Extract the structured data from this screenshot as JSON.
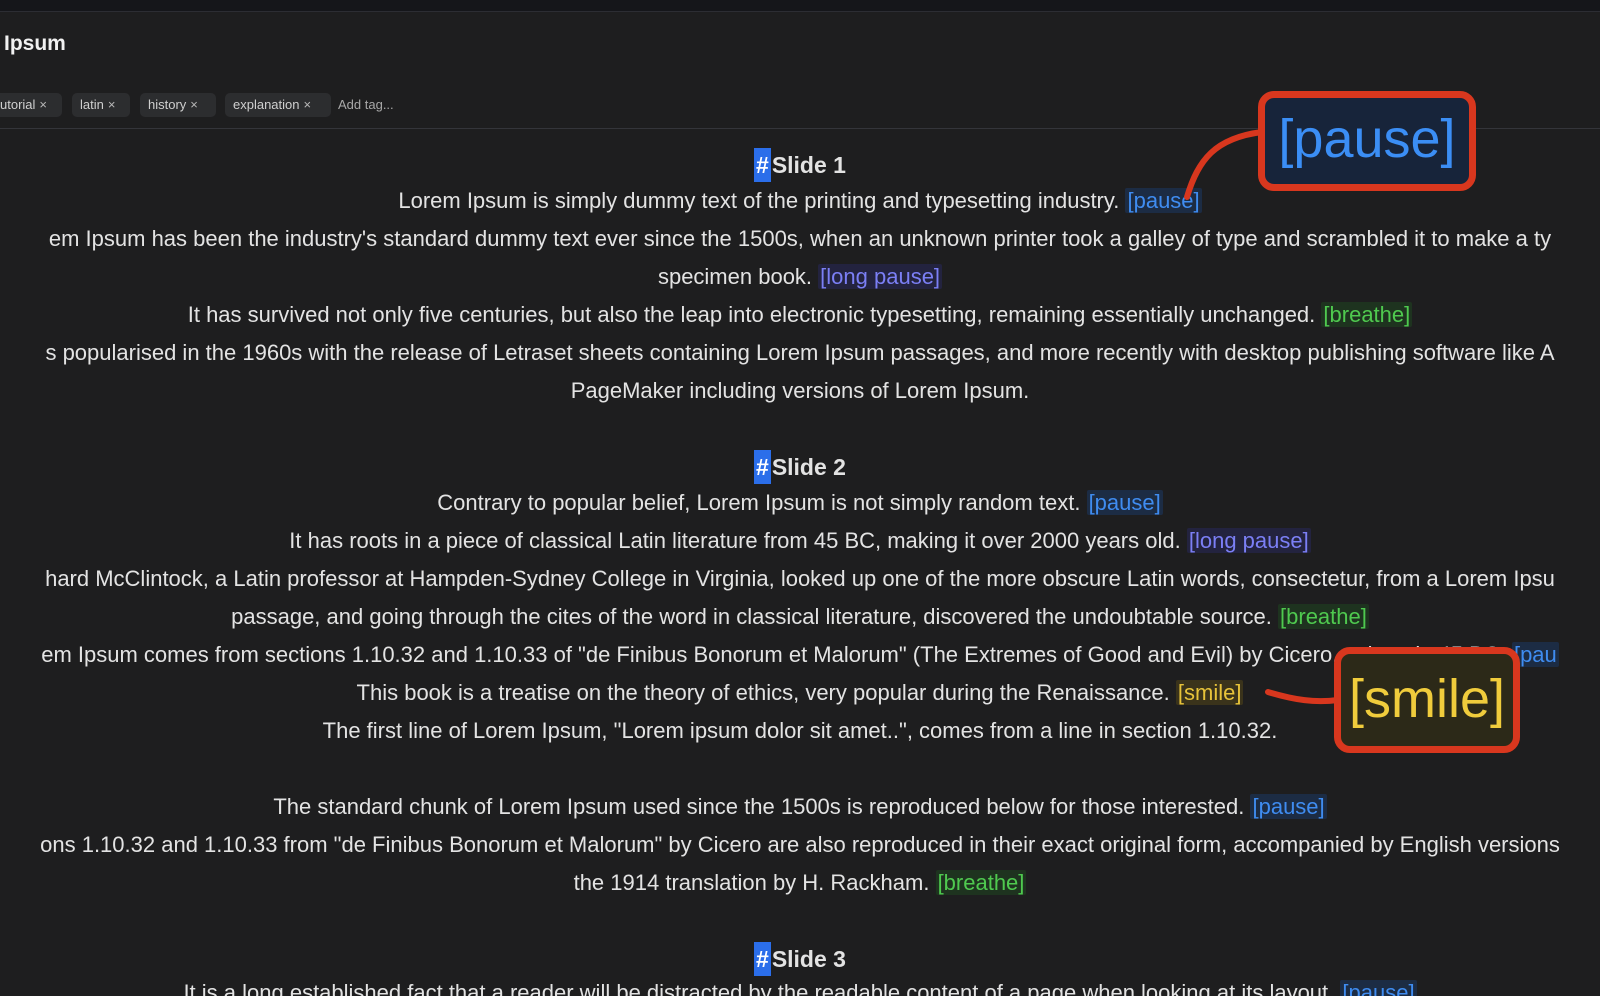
{
  "document": {
    "title": "Ipsum"
  },
  "tags": {
    "items": [
      {
        "label": "utorial"
      },
      {
        "label": "latin"
      },
      {
        "label": "history"
      },
      {
        "label": "explanation"
      }
    ],
    "remove_glyph": "×",
    "add_placeholder": "Add tag..."
  },
  "content": {
    "slide1": {
      "hash": "#",
      "heading": "Slide 1",
      "l1": "Lorem Ipsum is simply dummy text of the printing and typesetting industry.",
      "l1_cue": "[pause]",
      "l2": "em Ipsum has been the industry's standard dummy text ever since the 1500s, when an unknown printer took a galley of type and scrambled it to make a ty",
      "l3": "specimen book.",
      "l3_cue": "[long pause]",
      "l4": "It has survived not only five centuries, but also the leap into electronic typesetting, remaining essentially unchanged.",
      "l4_cue": "[breathe]",
      "l5": "s popularised in the 1960s with the release of Letraset sheets containing Lorem Ipsum passages, and more recently with desktop publishing software like A",
      "l6": "PageMaker including versions of Lorem Ipsum."
    },
    "slide2": {
      "hash": "#",
      "heading": "Slide 2",
      "l1": "Contrary to popular belief, Lorem Ipsum is not simply random text.",
      "l1_cue": "[pause]",
      "l2": "It has roots in a piece of classical Latin literature from 45 BC, making it over 2000 years old.",
      "l2_cue": "[long pause]",
      "l3": "hard McClintock, a Latin professor at Hampden-Sydney College in Virginia, looked up one of the more obscure Latin words, consectetur, from a Lorem Ipsu",
      "l4": "passage, and going through the cites of the word in classical literature, discovered the undoubtable source.",
      "l4_cue": "[breathe]",
      "l5": "em Ipsum comes from sections 1.10.32 and 1.10.33 of \"de Finibus Bonorum et Malorum\" (The Extremes of Good and Evil) by Cicero, written in 45 BC.",
      "l5_cue": "[pau",
      "l6": "This book is a treatise on the theory of ethics, very popular during the Renaissance.",
      "l6_cue": "[smile]",
      "l7": "The first line of Lorem Ipsum, \"Lorem ipsum dolor sit amet..\", comes from a line in section 1.10.32.",
      "l8": "The standard chunk of Lorem Ipsum used since the 1500s is reproduced below for those interested.",
      "l8_cue": "[pause]",
      "l9": "ons 1.10.32 and 1.10.33 from \"de Finibus Bonorum et Malorum\" by Cicero are also reproduced in their exact original form, accompanied by English versions",
      "l10": "the 1914 translation by H. Rackham.",
      "l10_cue": "[breathe]"
    },
    "slide3": {
      "hash": "#",
      "heading": "Slide 3",
      "l1": "It is a long established fact that a reader will be distracted by the readable content of a page when looking at its layout.",
      "l1_cue": "[pause]"
    }
  },
  "callouts": {
    "pause": "[pause]",
    "smile": "[smile]"
  },
  "colors": {
    "background": "#1e1e1f",
    "pause": "#3f8cf0",
    "long_pause": "#7b7ff5",
    "breathe": "#4fc94f",
    "smile": "#e7c33a",
    "callout_border": "#d8371e",
    "heading_hash": "#2b6eea"
  }
}
